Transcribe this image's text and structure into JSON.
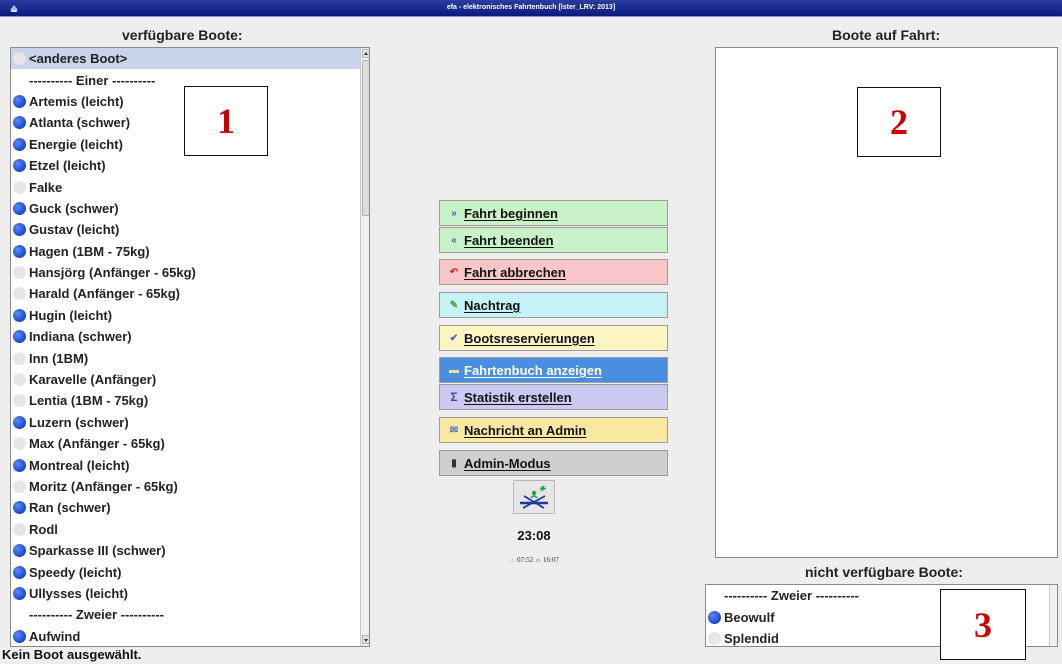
{
  "window": {
    "title": "efa - elektronisches Fahrtenbuch [lster_LRV: 2013]"
  },
  "available_boats": {
    "heading": "verfügbare Boote:",
    "items": [
      {
        "label": "<anderes Boot>",
        "dot": "gray",
        "selected": true
      },
      {
        "label": "---------- Einer ----------",
        "separator": true
      },
      {
        "label": "Artemis (leicht)",
        "dot": "blue"
      },
      {
        "label": "Atlanta (schwer)",
        "dot": "blue"
      },
      {
        "label": "Energie (leicht)",
        "dot": "blue"
      },
      {
        "label": "Etzel (leicht)",
        "dot": "blue"
      },
      {
        "label": "Falke",
        "dot": "gray"
      },
      {
        "label": "Guck (schwer)",
        "dot": "blue"
      },
      {
        "label": "Gustav (leicht)",
        "dot": "blue"
      },
      {
        "label": "Hagen (1BM - 75kg)",
        "dot": "blue"
      },
      {
        "label": "Hansjörg (Anfänger - 65kg)",
        "dot": "gray"
      },
      {
        "label": "Harald (Anfänger - 65kg)",
        "dot": "gray"
      },
      {
        "label": "Hugin (leicht)",
        "dot": "blue"
      },
      {
        "label": "Indiana (schwer)",
        "dot": "blue"
      },
      {
        "label": "Inn (1BM)",
        "dot": "gray"
      },
      {
        "label": "Karavelle (Anfänger)",
        "dot": "gray"
      },
      {
        "label": "Lentia (1BM - 75kg)",
        "dot": "gray"
      },
      {
        "label": "Luzern (schwer)",
        "dot": "blue"
      },
      {
        "label": "Max (Anfänger - 65kg)",
        "dot": "gray"
      },
      {
        "label": "Montreal (leicht)",
        "dot": "blue"
      },
      {
        "label": "Moritz (Anfänger - 65kg)",
        "dot": "gray"
      },
      {
        "label": "Ran (schwer)",
        "dot": "blue"
      },
      {
        "label": "Rodl",
        "dot": "gray"
      },
      {
        "label": "Sparkasse III (schwer)",
        "dot": "blue"
      },
      {
        "label": "Speedy (leicht)",
        "dot": "blue"
      },
      {
        "label": "Ullysses (leicht)",
        "dot": "blue"
      },
      {
        "label": "---------- Zweier ----------",
        "separator": true
      },
      {
        "label": "Aufwind",
        "dot": "blue"
      }
    ]
  },
  "boats_on_trip": {
    "heading": "Boote auf Fahrt:",
    "items": []
  },
  "unavailable_boats": {
    "heading": "nicht verfügbare Boote:",
    "items": [
      {
        "label": "---------- Zweier ----------",
        "separator": true
      },
      {
        "label": "Beowulf",
        "dot": "blue"
      },
      {
        "label": "Splendid",
        "dot": "gray"
      }
    ]
  },
  "buttons": {
    "start_trip": "Fahrt beginnen",
    "end_trip": "Fahrt beenden",
    "cancel_trip": "Fahrt abbrechen",
    "late_entry": "Nachtrag",
    "reservations": "Bootsreservierungen",
    "show_logbook": "Fahrtenbuch anzeigen",
    "statistics": "Statistik erstellen",
    "message_admin": "Nachricht an Admin",
    "admin_mode": "Admin-Modus"
  },
  "clock": {
    "time": "23:08",
    "sunrise": "07:52",
    "sunset": "16:07"
  },
  "status": {
    "text": "Kein Boot ausgewählt."
  },
  "annotations": {
    "box1": "1",
    "box2": "2",
    "box3": "3"
  },
  "colors": {
    "titlebar": "#0a1a7c",
    "start_trip_bg": "#c9f2c9",
    "cancel_trip_bg": "#f8c6c6",
    "late_entry_bg": "#c6f1f6",
    "reservations_bg": "#fbf5c1",
    "show_logbook_bg": "#4a8ee0",
    "statistics_bg": "#cbc8f2",
    "message_admin_bg": "#f8e8a0",
    "admin_mode_bg": "#cfcfcf",
    "annotation_text": "#cc0000",
    "available_dot": "#1746cf"
  }
}
